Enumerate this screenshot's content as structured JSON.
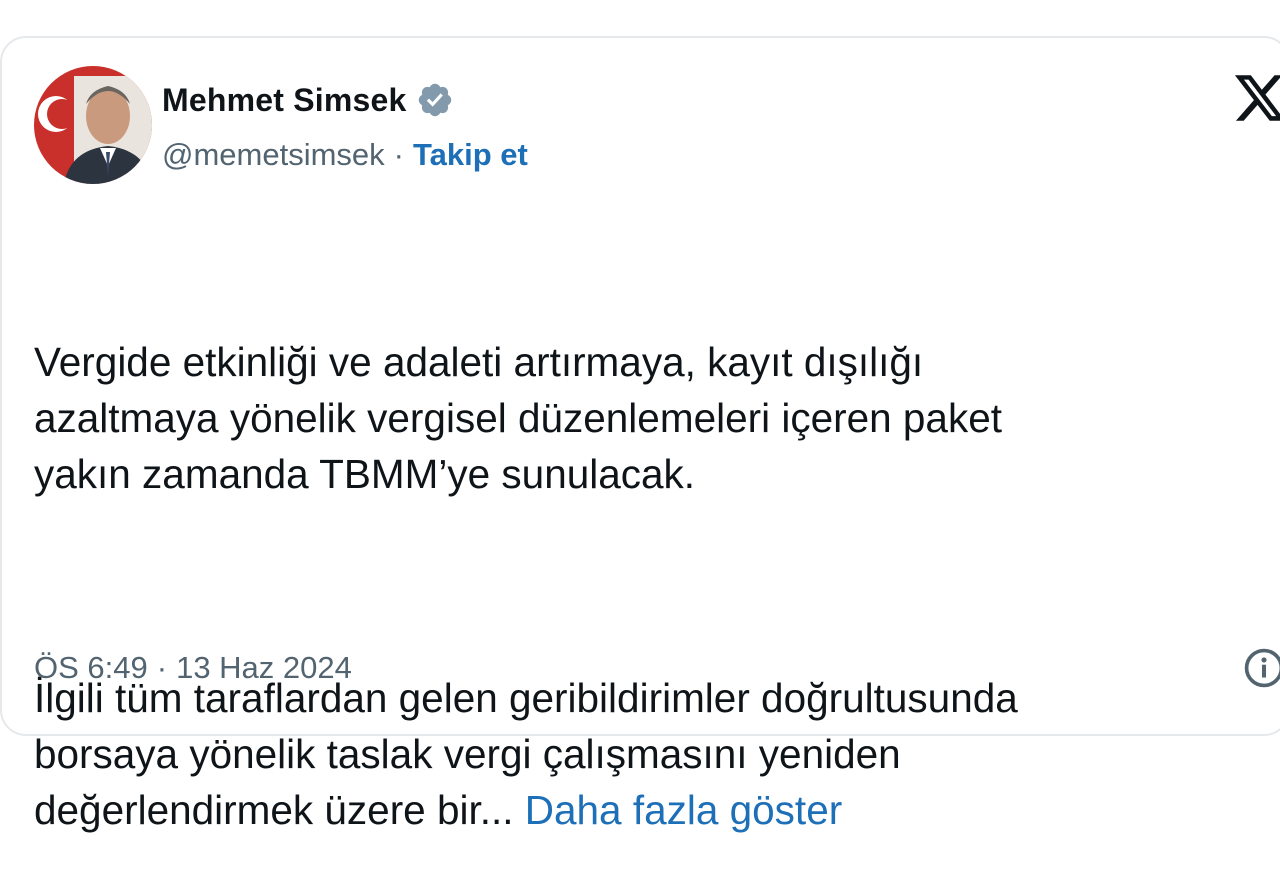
{
  "author": {
    "name": "Mehmet Simsek",
    "handle": "@memetsimsek",
    "separator": "·",
    "follow_label": "Takip et"
  },
  "tweet": {
    "paragraph1": "Vergide etkinliği ve adaleti artırmaya, kayıt dışılığı\nazaltmaya yönelik vergisel düzenlemeleri içeren paket\nyakın zamanda TBMM’ye sunulacak.",
    "paragraph2": "İlgili tüm taraflardan gelen geribildirimler doğrultusunda\nborsaya yönelik taslak vergi çalışmasını yeniden\ndeğerlendirmek üzere bir...",
    "show_more_label": "Daha fazla göster"
  },
  "meta": {
    "time": "ÖS 6:49",
    "separator": "·",
    "date": "13 Haz 2024"
  },
  "icons": {
    "verified": "verified-badge-icon",
    "brand": "x-logo-icon",
    "info": "info-icon"
  },
  "colors": {
    "link": "#1d6fb8",
    "text": "#0f1419",
    "muted": "#536471",
    "verified_badge": "#829aab"
  }
}
